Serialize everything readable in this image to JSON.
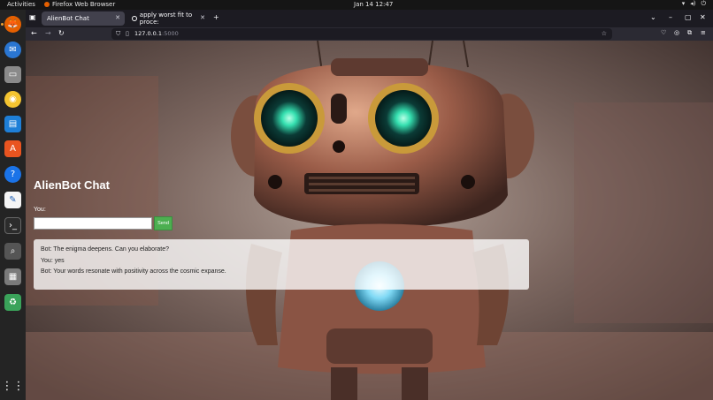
{
  "system_bar": {
    "activities": "Activities",
    "app_name": "Firefox Web Browser",
    "clock": "Jan 14  12:47"
  },
  "dock": {
    "apps": [
      {
        "name": "firefox",
        "color": "#e66000"
      },
      {
        "name": "thunderbird",
        "color": "#2a76d2"
      },
      {
        "name": "files",
        "color": "#8a8a8a"
      },
      {
        "name": "rhythmbox",
        "color": "#f4c430"
      },
      {
        "name": "writer",
        "color": "#1e7fd7"
      },
      {
        "name": "app-center",
        "color": "#e95420"
      },
      {
        "name": "help",
        "color": "#1a73e8"
      },
      {
        "name": "text-editor",
        "color": "#f5f5f5"
      },
      {
        "name": "terminal",
        "color": "#2c2c2c"
      },
      {
        "name": "screenshot",
        "color": "#555555"
      },
      {
        "name": "disks",
        "color": "#7a7a7a"
      },
      {
        "name": "trash",
        "color": "#3aa35a"
      }
    ]
  },
  "browser": {
    "tabs": [
      {
        "label": "AlienBot Chat",
        "active": true
      },
      {
        "label": "apply worst fit to proce:",
        "active": false
      }
    ],
    "url_host": "127.0.0.1",
    "url_port": ":5000"
  },
  "page": {
    "title": "AlienBot Chat",
    "input_label": "You:",
    "input_value": "",
    "send_label": "Send",
    "messages": [
      "Bot: The enigma deepens. Can you elaborate?",
      "You: yes",
      "Bot: Your words resonate with positivity across the cosmic expanse."
    ]
  },
  "colors": {
    "send_button": "#4caf50",
    "chat_log_bg": "#ffffffc7",
    "robot_eye": "#35e0b0"
  }
}
